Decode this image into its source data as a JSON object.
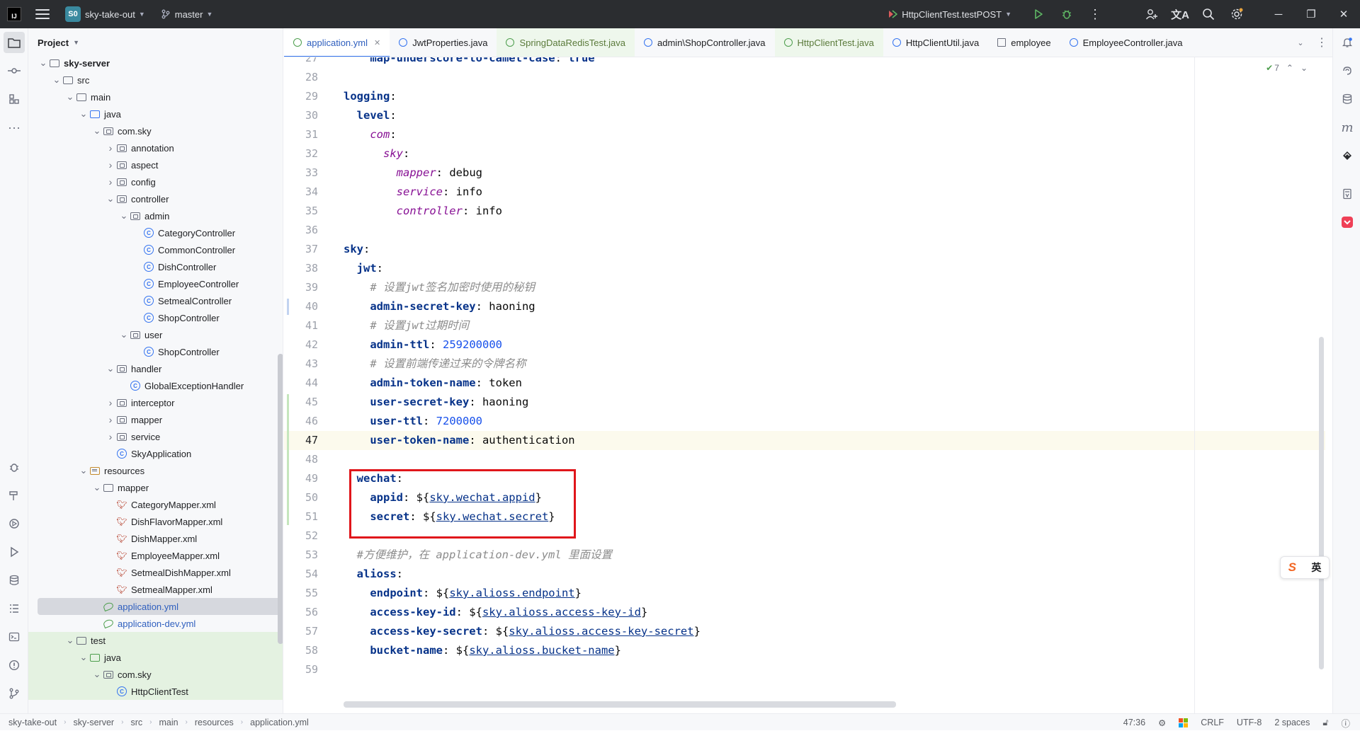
{
  "titlebar": {
    "project_badge": "S0",
    "project_name": "sky-take-out",
    "branch": "master",
    "run_config": "HttpClientTest.testPOST"
  },
  "project_panel": {
    "title": "Project",
    "tree": [
      {
        "label": "sky-server",
        "depth": 1,
        "type": "module",
        "open": true,
        "bold": true
      },
      {
        "label": "src",
        "depth": 2,
        "type": "folder",
        "open": true
      },
      {
        "label": "main",
        "depth": 3,
        "type": "folder",
        "open": true
      },
      {
        "label": "java",
        "depth": 4,
        "type": "src",
        "open": true
      },
      {
        "label": "com.sky",
        "depth": 5,
        "type": "pkg",
        "open": true
      },
      {
        "label": "annotation",
        "depth": 6,
        "type": "pkg",
        "open": false
      },
      {
        "label": "aspect",
        "depth": 6,
        "type": "pkg",
        "open": false
      },
      {
        "label": "config",
        "depth": 6,
        "type": "pkg",
        "open": false
      },
      {
        "label": "controller",
        "depth": 6,
        "type": "pkg",
        "open": true
      },
      {
        "label": "admin",
        "depth": 7,
        "type": "pkg",
        "open": true
      },
      {
        "label": "CategoryController",
        "depth": 8,
        "type": "class"
      },
      {
        "label": "CommonController",
        "depth": 8,
        "type": "class"
      },
      {
        "label": "DishController",
        "depth": 8,
        "type": "class"
      },
      {
        "label": "EmployeeController",
        "depth": 8,
        "type": "class"
      },
      {
        "label": "SetmealController",
        "depth": 8,
        "type": "class"
      },
      {
        "label": "ShopController",
        "depth": 8,
        "type": "class"
      },
      {
        "label": "user",
        "depth": 7,
        "type": "pkg",
        "open": true
      },
      {
        "label": "ShopController",
        "depth": 8,
        "type": "class"
      },
      {
        "label": "handler",
        "depth": 6,
        "type": "pkg",
        "open": true
      },
      {
        "label": "GlobalExceptionHandler",
        "depth": 7,
        "type": "class"
      },
      {
        "label": "interceptor",
        "depth": 6,
        "type": "pkg",
        "open": false
      },
      {
        "label": "mapper",
        "depth": 6,
        "type": "pkg",
        "open": false
      },
      {
        "label": "service",
        "depth": 6,
        "type": "pkg",
        "open": false
      },
      {
        "label": "SkyApplication",
        "depth": 6,
        "type": "class"
      },
      {
        "label": "resources",
        "depth": 4,
        "type": "res",
        "open": true
      },
      {
        "label": "mapper",
        "depth": 5,
        "type": "folder",
        "open": true
      },
      {
        "label": "CategoryMapper.xml",
        "depth": 6,
        "type": "xml"
      },
      {
        "label": "DishFlavorMapper.xml",
        "depth": 6,
        "type": "xml"
      },
      {
        "label": "DishMapper.xml",
        "depth": 6,
        "type": "xml"
      },
      {
        "label": "EmployeeMapper.xml",
        "depth": 6,
        "type": "xml"
      },
      {
        "label": "SetmealDishMapper.xml",
        "depth": 6,
        "type": "xml"
      },
      {
        "label": "SetmealMapper.xml",
        "depth": 6,
        "type": "xml"
      },
      {
        "label": "application.yml",
        "depth": 5,
        "type": "yml",
        "selected": true
      },
      {
        "label": "application-dev.yml",
        "depth": 5,
        "type": "yml"
      },
      {
        "label": "test",
        "depth": 3,
        "type": "folder",
        "open": true,
        "green": true
      },
      {
        "label": "java",
        "depth": 4,
        "type": "testsrc",
        "open": true,
        "green": true
      },
      {
        "label": "com.sky",
        "depth": 5,
        "type": "pkg",
        "open": true,
        "green": true
      },
      {
        "label": "HttpClientTest",
        "depth": 6,
        "type": "class",
        "green": true
      }
    ]
  },
  "tabs": [
    {
      "label": "application.yml",
      "icon": "yaml-icon",
      "active": true
    },
    {
      "label": "JwtProperties.java",
      "icon": "class-icon"
    },
    {
      "label": "SpringDataRedisTest.java",
      "icon": "test-class-icon",
      "test": true
    },
    {
      "label": "admin\\ShopController.java",
      "icon": "class-icon"
    },
    {
      "label": "HttpClientTest.java",
      "icon": "test-class-icon",
      "test": true
    },
    {
      "label": "HttpClientUtil.java",
      "icon": "class-icon"
    },
    {
      "label": "employee",
      "icon": "table-icon"
    },
    {
      "label": "EmployeeController.java",
      "icon": "class-icon"
    }
  ],
  "editor": {
    "inspection_count": "7",
    "lines": [
      {
        "n": "27",
        "parts": [
          {
            "c": "kb",
            "t": "    map-underscore-to-camel-case"
          },
          {
            "c": "plain",
            "t": ": "
          },
          {
            "c": "kb",
            "t": "true"
          }
        ]
      },
      {
        "n": "28",
        "parts": []
      },
      {
        "n": "29",
        "parts": [
          {
            "c": "kb",
            "t": "logging"
          },
          {
            "c": "plain",
            "t": ":"
          }
        ]
      },
      {
        "n": "30",
        "parts": [
          {
            "c": "kb",
            "t": "  level"
          },
          {
            "c": "plain",
            "t": ":"
          }
        ]
      },
      {
        "n": "31",
        "parts": [
          {
            "c": "ki",
            "t": "    com"
          },
          {
            "c": "plain",
            "t": ":"
          }
        ]
      },
      {
        "n": "32",
        "parts": [
          {
            "c": "ki",
            "t": "      sky"
          },
          {
            "c": "plain",
            "t": ":"
          }
        ]
      },
      {
        "n": "33",
        "parts": [
          {
            "c": "ki",
            "t": "        mapper"
          },
          {
            "c": "plain",
            "t": ": debug"
          }
        ]
      },
      {
        "n": "34",
        "parts": [
          {
            "c": "ki",
            "t": "        service"
          },
          {
            "c": "plain",
            "t": ": info"
          }
        ]
      },
      {
        "n": "35",
        "parts": [
          {
            "c": "ki",
            "t": "        controller"
          },
          {
            "c": "plain",
            "t": ": info"
          }
        ]
      },
      {
        "n": "36",
        "parts": []
      },
      {
        "n": "37",
        "parts": [
          {
            "c": "kb",
            "t": "sky"
          },
          {
            "c": "plain",
            "t": ":"
          }
        ]
      },
      {
        "n": "38",
        "parts": [
          {
            "c": "kb",
            "t": "  jwt"
          },
          {
            "c": "plain",
            "t": ":"
          }
        ]
      },
      {
        "n": "39",
        "parts": [
          {
            "c": "cmt",
            "t": "    # 设置jwt签名加密时使用的秘钥"
          }
        ]
      },
      {
        "n": "40",
        "parts": [
          {
            "c": "kb",
            "t": "    admin-secret-key"
          },
          {
            "c": "plain",
            "t": ": haoning"
          }
        ]
      },
      {
        "n": "41",
        "parts": [
          {
            "c": "cmt",
            "t": "    # 设置jwt过期时间"
          }
        ]
      },
      {
        "n": "42",
        "parts": [
          {
            "c": "kb",
            "t": "    admin-ttl"
          },
          {
            "c": "plain",
            "t": ": "
          },
          {
            "c": "num",
            "t": "259200000"
          }
        ]
      },
      {
        "n": "43",
        "parts": [
          {
            "c": "cmt",
            "t": "    # 设置前端传递过来的令牌名称"
          }
        ]
      },
      {
        "n": "44",
        "parts": [
          {
            "c": "kb",
            "t": "    admin-token-name"
          },
          {
            "c": "plain",
            "t": ": token"
          }
        ]
      },
      {
        "n": "45",
        "parts": [
          {
            "c": "kb",
            "t": "    user-secret-key"
          },
          {
            "c": "plain",
            "t": ": haoning"
          }
        ]
      },
      {
        "n": "46",
        "parts": [
          {
            "c": "kb",
            "t": "    user-ttl"
          },
          {
            "c": "plain",
            "t": ": "
          },
          {
            "c": "num",
            "t": "7200000"
          }
        ]
      },
      {
        "n": "47",
        "parts": [
          {
            "c": "kb",
            "t": "    user-token-name"
          },
          {
            "c": "plain",
            "t": ": authentication"
          }
        ],
        "current": true
      },
      {
        "n": "48",
        "parts": []
      },
      {
        "n": "49",
        "parts": [
          {
            "c": "kb",
            "t": "  wechat"
          },
          {
            "c": "plain",
            "t": ":"
          }
        ]
      },
      {
        "n": "50",
        "parts": [
          {
            "c": "kb",
            "t": "    appid"
          },
          {
            "c": "plain",
            "t": ": ${"
          },
          {
            "c": "ref",
            "t": "sky.wechat.appid"
          },
          {
            "c": "plain",
            "t": "}"
          }
        ]
      },
      {
        "n": "51",
        "parts": [
          {
            "c": "kb",
            "t": "    secret"
          },
          {
            "c": "plain",
            "t": ": ${"
          },
          {
            "c": "ref",
            "t": "sky.wechat.secret"
          },
          {
            "c": "plain",
            "t": "}"
          }
        ]
      },
      {
        "n": "52",
        "parts": []
      },
      {
        "n": "53",
        "parts": [
          {
            "c": "cmt",
            "t": "  #方便维护，在 application-dev.yml 里面设置"
          }
        ]
      },
      {
        "n": "54",
        "parts": [
          {
            "c": "kb",
            "t": "  alioss"
          },
          {
            "c": "plain",
            "t": ":"
          }
        ]
      },
      {
        "n": "55",
        "parts": [
          {
            "c": "kb",
            "t": "    endpoint"
          },
          {
            "c": "plain",
            "t": ": ${"
          },
          {
            "c": "ref",
            "t": "sky.alioss.endpoint"
          },
          {
            "c": "plain",
            "t": "}"
          }
        ]
      },
      {
        "n": "56",
        "parts": [
          {
            "c": "kb",
            "t": "    access-key-id"
          },
          {
            "c": "plain",
            "t": ": ${"
          },
          {
            "c": "ref",
            "t": "sky.alioss.access-key-id"
          },
          {
            "c": "plain",
            "t": "}"
          }
        ]
      },
      {
        "n": "57",
        "parts": [
          {
            "c": "kb",
            "t": "    access-key-secret"
          },
          {
            "c": "plain",
            "t": ": ${"
          },
          {
            "c": "ref",
            "t": "sky.alioss.access-key-secret"
          },
          {
            "c": "plain",
            "t": "}"
          }
        ]
      },
      {
        "n": "58",
        "parts": [
          {
            "c": "kb",
            "t": "    bucket-name"
          },
          {
            "c": "plain",
            "t": ": ${"
          },
          {
            "c": "ref",
            "t": "sky.alioss.bucket-name"
          },
          {
            "c": "plain",
            "t": "}"
          }
        ]
      },
      {
        "n": "59",
        "parts": []
      }
    ]
  },
  "ime": {
    "logo": "S",
    "mode": "英"
  },
  "statusbar": {
    "breadcrumbs": [
      "sky-take-out",
      "sky-server",
      "src",
      "main",
      "resources",
      "application.yml"
    ],
    "position": "47:36",
    "line_sep": "CRLF",
    "encoding": "UTF-8",
    "indent": "2 spaces"
  },
  "colors": {
    "accent": "#3574f0",
    "highlight_box": "#e0161b",
    "titlebar": "#2b2d30"
  }
}
